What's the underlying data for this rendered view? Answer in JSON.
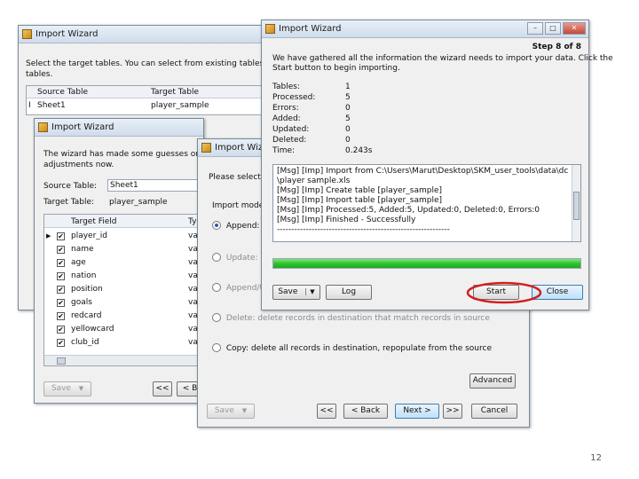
{
  "win1": {
    "title": "Import Wizard",
    "instructions": "Select the target tables. You can select from existing tables or input",
    "instructions2": "tables.",
    "col_source": "Source Table",
    "col_target": "Target Table",
    "row_marker": "I",
    "row_source": "Sheet1",
    "row_target": "player_sample"
  },
  "win2": {
    "title": "Import Wizard",
    "intro1": "The wizard has made some guesses on your",
    "intro2": "adjustments now.",
    "source_label": "Source Table:",
    "source_value": "Sheet1",
    "target_label": "Target Table:",
    "target_value": "player_sample",
    "col_target_field": "Target Field",
    "col_ty": "Ty",
    "fields": [
      {
        "name": "player_id",
        "type": "var"
      },
      {
        "name": "name",
        "type": "var"
      },
      {
        "name": "age",
        "type": "var"
      },
      {
        "name": "nation",
        "type": "var"
      },
      {
        "name": "position",
        "type": "var"
      },
      {
        "name": "goals",
        "type": "var"
      },
      {
        "name": "redcard",
        "type": "var"
      },
      {
        "name": "yellowcard",
        "type": "var"
      },
      {
        "name": "club_id",
        "type": "var"
      }
    ],
    "check_mark": "✔",
    "save_label": "Save",
    "first_label": "<<",
    "back_label": "< B"
  },
  "win3": {
    "title": "Import Wiz",
    "intro": "Please select a d",
    "mode_label": "Import mode",
    "opt_append": "Append: ac",
    "opt_update": "Update: up",
    "opt_append_update": "Append/U",
    "opt_delete": "Delete: delete records in destination that match records in source",
    "opt_copy": "Copy: delete all records in destination, repopulate from the source",
    "advanced_label": "Advanced",
    "save_label": "Save",
    "first_label": "<<",
    "back_label": "< Back",
    "next_label": "Next >",
    "last_label": ">>",
    "cancel_label": "Cancel"
  },
  "win4": {
    "title": "Import Wizard",
    "step": "Step 8 of 8",
    "intro1": "We have gathered all the information the wizard needs to import your data. Click the",
    "intro2": "Start button to begin importing.",
    "stats": [
      {
        "label": "Tables:",
        "value": "1"
      },
      {
        "label": "Processed:",
        "value": "5"
      },
      {
        "label": "Errors:",
        "value": "0"
      },
      {
        "label": "Added:",
        "value": "5"
      },
      {
        "label": "Updated:",
        "value": "0"
      },
      {
        "label": "Deleted:",
        "value": "0"
      },
      {
        "label": "Time:",
        "value": "0.243s"
      }
    ],
    "log": [
      "[Msg] [Imp] Import from    C:\\Users\\Marut\\Desktop\\SKM_user_tools\\data\\dc",
      "\\player sample.xls",
      "[Msg] [Imp] Create table [player_sample]",
      "[Msg] [Imp] Import table [player_sample]",
      "[Msg] [Imp] Processed:5, Added:5, Updated:0, Deleted:0, Errors:0",
      "[Msg] [Imp] Finished - Successfully",
      "------------------------------------------------------------"
    ],
    "progress_fraction": 1.0,
    "save_label": "Save",
    "log_label": "Log",
    "start_label": "Start",
    "close_label": "Close"
  },
  "page_number": "12",
  "colors": {
    "progress": "#2fc42f",
    "highlight_ellipse": "#d21f1f"
  }
}
